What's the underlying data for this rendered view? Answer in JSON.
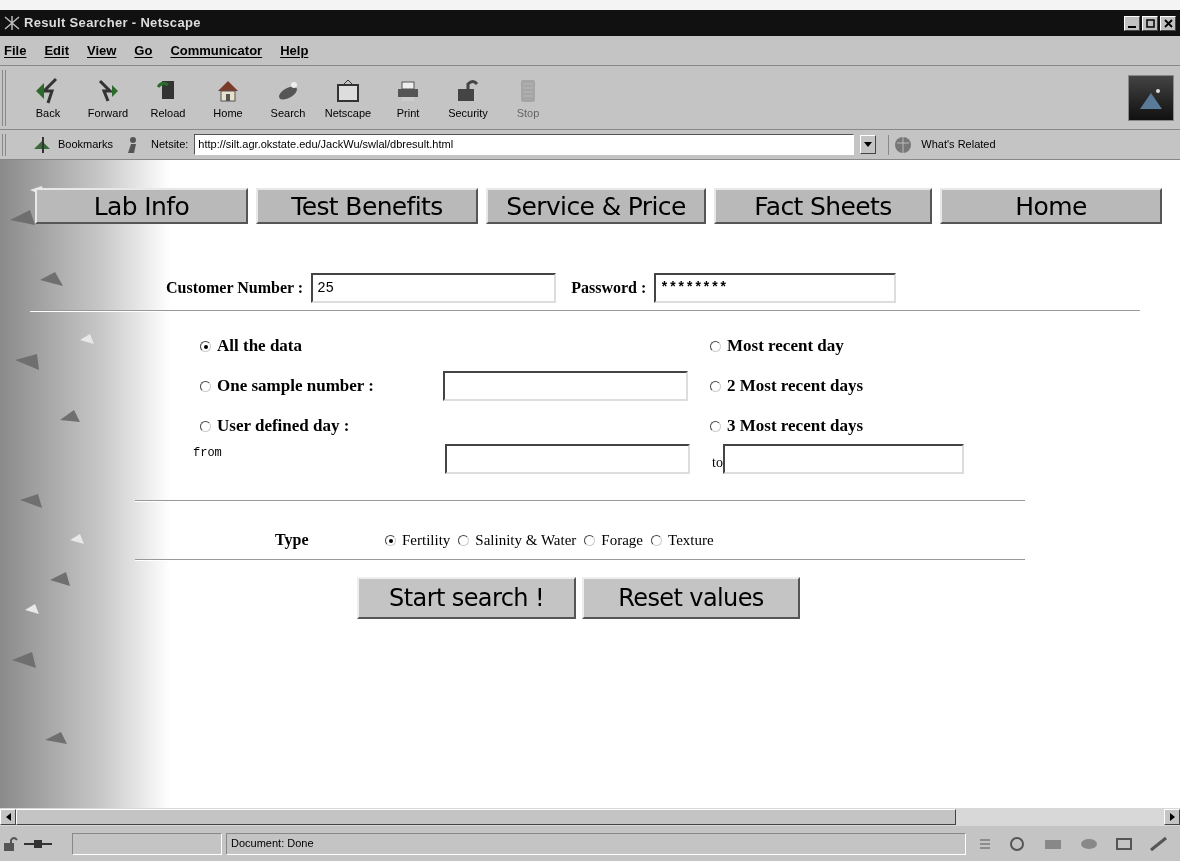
{
  "window": {
    "title": "Result Searcher - Netscape"
  },
  "menu": [
    "File",
    "Edit",
    "View",
    "Go",
    "Communicator",
    "Help"
  ],
  "toolbar": [
    {
      "label": "Back",
      "disabled": false
    },
    {
      "label": "Forward",
      "disabled": false
    },
    {
      "label": "Reload",
      "disabled": false
    },
    {
      "label": "Home",
      "disabled": false
    },
    {
      "label": "Search",
      "disabled": false
    },
    {
      "label": "Netscape",
      "disabled": false
    },
    {
      "label": "Print",
      "disabled": false
    },
    {
      "label": "Security",
      "disabled": false
    },
    {
      "label": "Stop",
      "disabled": true
    }
  ],
  "location_bar": {
    "bookmarks": "Bookmarks",
    "label": "Netsite:",
    "url": "http://silt.agr.okstate.edu/JackWu/swlal/dbresult.html",
    "related": "What's Related"
  },
  "nav": [
    "Lab Info",
    "Test Benefits",
    "Service & Price",
    "Fact Sheets",
    "Home"
  ],
  "login": {
    "customer_label": "Customer Number :",
    "customer_value": "25",
    "password_label": "Password :",
    "password_value": "********"
  },
  "range_options": [
    {
      "label": "All the data",
      "selected": true,
      "field": false
    },
    {
      "label": "Most recent day",
      "selected": false,
      "field": false
    },
    {
      "label": "One sample number :",
      "selected": false,
      "field": true
    },
    {
      "label": "2 Most recent days",
      "selected": false,
      "field": false
    },
    {
      "label": "User defined day :",
      "selected": false,
      "field": false
    },
    {
      "label": "3 Most recent days",
      "selected": false,
      "field": false
    }
  ],
  "date_range": {
    "from_label": "from",
    "to_label": "to"
  },
  "type": {
    "label": "Type",
    "options": [
      {
        "label": "Fertility",
        "selected": true
      },
      {
        "label": "Salinity & Water",
        "selected": false
      },
      {
        "label": "Forage",
        "selected": false
      },
      {
        "label": "Texture",
        "selected": false
      }
    ]
  },
  "buttons": [
    "Start search !",
    "Reset values"
  ],
  "status_bar": {
    "text": "Document: Done"
  }
}
